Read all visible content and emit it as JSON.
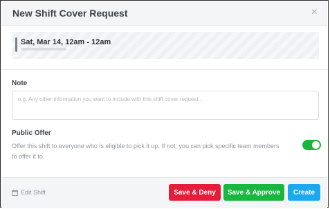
{
  "dialog": {
    "title": "New Shift Cover Request",
    "close_icon": "×"
  },
  "shift": {
    "time": "Sat, Mar 14, 12am - 12am"
  },
  "note": {
    "label": "Note",
    "placeholder": "e.g. Any other information you want to include with this shift cover request..."
  },
  "public_offer": {
    "label": "Public Offer",
    "description": "Offer this shift to everyone who is eligible to pick it up. If not, you can pick specific team members to offer it to.",
    "enabled": true
  },
  "footer": {
    "edit_shift_label": "Edit Shift",
    "deny_label": "Save & Deny",
    "approve_label": "Save & Approve",
    "create_label": "Create"
  },
  "colors": {
    "deny": "#e51c3a",
    "approve": "#18b73f",
    "create": "#1aa8ef",
    "toggle_on": "#19b53e"
  }
}
